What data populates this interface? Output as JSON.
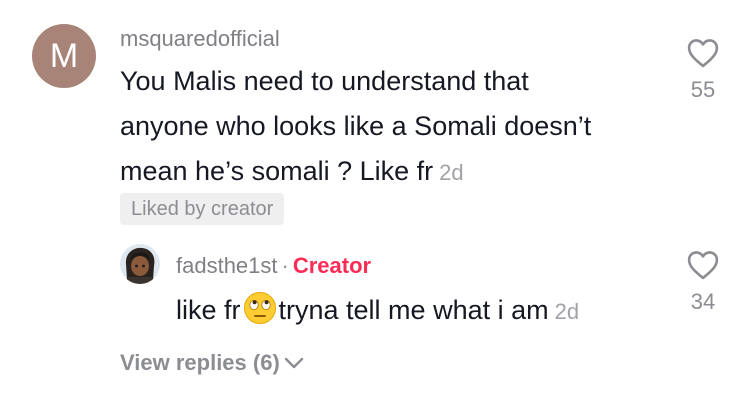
{
  "comment": {
    "avatar_letter": "M",
    "username": "msquaredofficial",
    "text_line1": "You Malis need to understand that",
    "text_line2": "anyone who looks like a Somali doesn’t",
    "text_line3": "mean he’s somali ? Like fr",
    "timestamp": "2d",
    "liked_badge": "Liked by creator",
    "like_count": "55"
  },
  "reply": {
    "username": "fadsthe1st",
    "separator": "·",
    "creator_label": "Creator",
    "text_before": "like fr",
    "emoji": "eye-roll-emoji",
    "text_after": "tryna tell me what i am",
    "timestamp": "2d",
    "like_count": "34"
  },
  "view_replies_label": "View replies (6)",
  "colors": {
    "text": "#161823",
    "muted": "#8c8d92",
    "creator": "#fe2c55",
    "avatar_bg": "#a88478",
    "badge_bg": "#efefef"
  }
}
